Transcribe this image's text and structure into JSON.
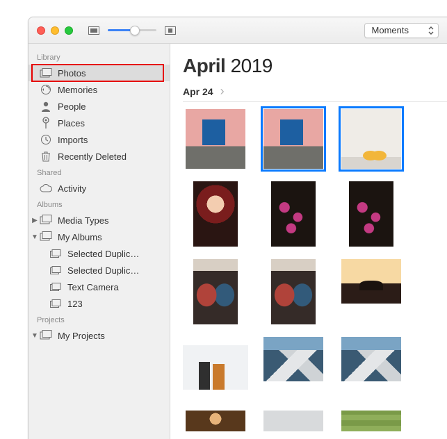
{
  "toolbar": {
    "dropdown_label": "Moments"
  },
  "sidebar": {
    "sections": {
      "library": {
        "label": "Library"
      },
      "shared": {
        "label": "Shared"
      },
      "albums": {
        "label": "Albums"
      },
      "projects": {
        "label": "Projects"
      }
    },
    "library_items": [
      {
        "label": "Photos"
      },
      {
        "label": "Memories"
      },
      {
        "label": "People"
      },
      {
        "label": "Places"
      },
      {
        "label": "Imports"
      },
      {
        "label": "Recently Deleted"
      }
    ],
    "shared_items": [
      {
        "label": "Activity"
      }
    ],
    "albums_items": [
      {
        "label": "Media Types"
      },
      {
        "label": "My Albums"
      }
    ],
    "my_albums_children": [
      {
        "label": "Selected Duplic…"
      },
      {
        "label": "Selected Duplic…"
      },
      {
        "label": "Text Camera"
      },
      {
        "label": "123"
      }
    ],
    "projects_items": [
      {
        "label": "My Projects"
      }
    ]
  },
  "main": {
    "title_month": "April",
    "title_year": "2019",
    "date_label": "Apr 24"
  }
}
